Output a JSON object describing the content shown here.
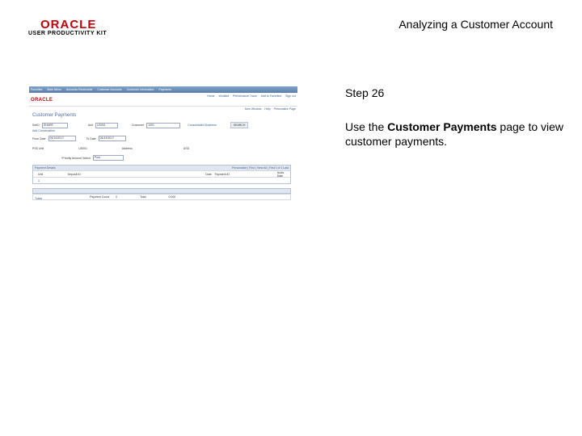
{
  "header": {
    "logo_text": "ORACLE",
    "logo_subtitle": "USER PRODUCTIVITY KIT",
    "doc_title": "Analyzing a Customer Account"
  },
  "step": {
    "label": "Step 26",
    "text_before": "Use the ",
    "text_bold": "Customer Payments",
    "text_after": " page to view customer payments."
  },
  "screenshot": {
    "nav_items": [
      "Favorites",
      "Main Menu",
      "Accounts Receivable",
      "Customer Accounts",
      "Customer Information",
      "Payments"
    ],
    "logo": "ORACLE",
    "top_links": [
      "Home",
      "Worklist",
      "Performance Trace",
      "Add to Favorites",
      "Sign out"
    ],
    "sub_links": [
      "New Window",
      "Help",
      "Personalize Page"
    ],
    "page_title": "Customer Payments",
    "fields": {
      "setid_label": "SetID",
      "setid_value": "SHARE",
      "unit_label": "Unit",
      "unit_value": "US001",
      "customer_label": "Customer",
      "customer_value": "1001",
      "consolidated_label": "Consolidated Business",
      "search_button": "SEARCH",
      "add_conversation_link": "Add Conversation",
      "from_date_label": "From Date",
      "from_date_value": "04/10/2017",
      "to_date_label": "To Date",
      "to_date_value": "04/13/2017",
      "row2_label_a": "PSS Unit",
      "row2_value_a": "US001",
      "row2_label_b": "Address",
      "row2_value_b": "USD",
      "priority_label": "*Priority Amount Select",
      "priority_value": "Post"
    },
    "grid": {
      "title": "Payment Details",
      "nav": "Personalize | Find | View All | First 1 of 1 Last",
      "columns": [
        "Unit",
        "Deposit ID",
        "Date",
        "Payment ID",
        "Accts Date"
      ],
      "rows": [
        [
          "1",
          "",
          "",
          "",
          ""
        ]
      ]
    },
    "totals": {
      "title": "Totals",
      "label_a": "Payment Count",
      "value_a": "0",
      "label_b": "Total",
      "value_b": "0.000"
    }
  }
}
